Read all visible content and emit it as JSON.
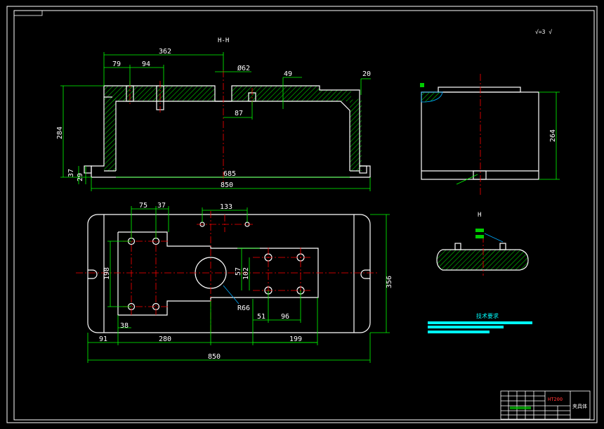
{
  "view_labels": {
    "front": "H-H",
    "section": "H"
  },
  "surface_note": "√=3 √",
  "dimensions": {
    "d362": "362",
    "d79": "79",
    "d94": "94",
    "phi62": "Ø62",
    "d49": "49",
    "d20": "20",
    "d87": "87",
    "d284": "284",
    "d37": "37",
    "d29": "29",
    "d685": "685",
    "d850_top": "850",
    "d264": "264",
    "d75": "75",
    "d37b": "37",
    "d133": "133",
    "d198": "198",
    "d57": "57",
    "d102": "102",
    "r66": "R66",
    "d38": "38",
    "d51": "51",
    "d96": "96",
    "d356": "356",
    "d91": "91",
    "d280": "280",
    "d199": "199",
    "d850_bottom": "850"
  },
  "notes_heading": "技术要求",
  "title_block": {
    "material": "HT200",
    "name": "夹具体"
  },
  "colors": {
    "outline": "#ffffff",
    "dimension": "#00ff00",
    "centerline": "#ff0000",
    "hatch": "#00cc00",
    "leader": "#00aaff",
    "note_bars": "#00ffff",
    "material_text": "#ff3333"
  }
}
